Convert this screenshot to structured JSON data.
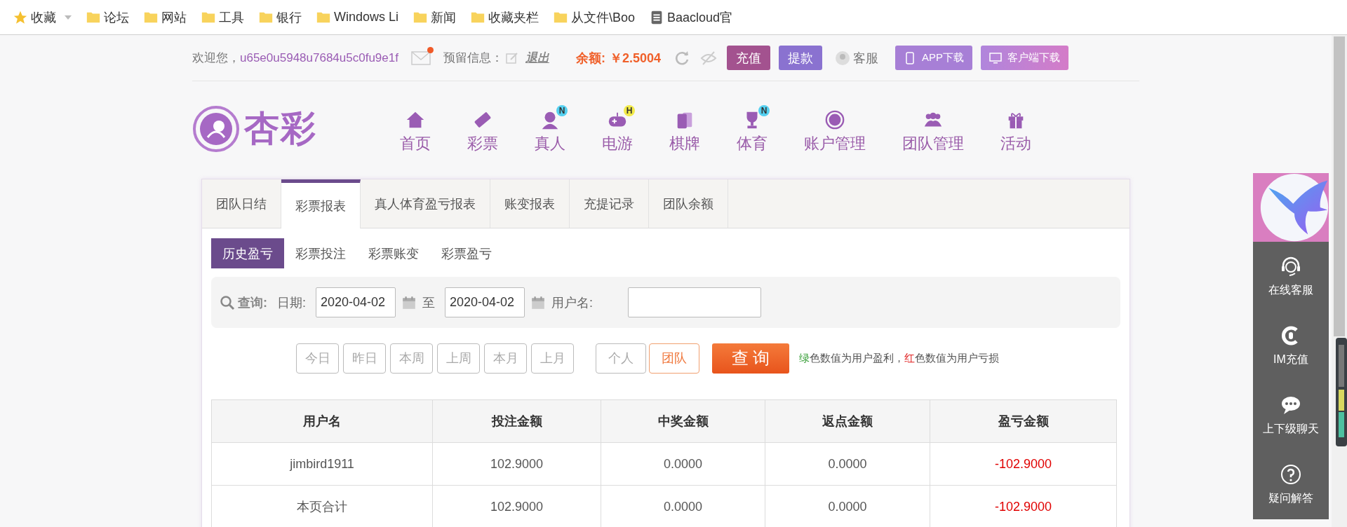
{
  "bookmarks": [
    {
      "label": "收藏",
      "kind": "star"
    },
    {
      "label": "论坛",
      "kind": "folder"
    },
    {
      "label": "网站",
      "kind": "folder"
    },
    {
      "label": "工具",
      "kind": "folder"
    },
    {
      "label": "银行",
      "kind": "folder"
    },
    {
      "label": "Windows Li",
      "kind": "folder"
    },
    {
      "label": "新闻",
      "kind": "folder"
    },
    {
      "label": "收藏夹栏",
      "kind": "folder"
    },
    {
      "label": "从文件\\Boo",
      "kind": "folder"
    },
    {
      "label": "Baacloud官",
      "kind": "page"
    }
  ],
  "account_bar": {
    "greeting": "欢迎您，",
    "username": "u65e0u5948u7684u5c0fu9e1f",
    "mail_unread": true,
    "reserve_label": "预留信息：",
    "logout": "退出",
    "balance_label": "余额:",
    "balance": "￥2.5004",
    "buttons": [
      {
        "label": "充值",
        "kind": "deposit"
      },
      {
        "label": "提款",
        "kind": "withdraw"
      }
    ],
    "service": "客服",
    "downloads": [
      {
        "label": "APP下载",
        "kind": "app"
      },
      {
        "label": "客户端下载",
        "kind": "client"
      }
    ]
  },
  "logo": {
    "text": "杏彩"
  },
  "nav": [
    {
      "label": "首页",
      "kind": "home"
    },
    {
      "label": "彩票",
      "kind": "ticket"
    },
    {
      "label": "真人",
      "kind": "live",
      "badge": {
        "text": "N",
        "color": "#55d0f0"
      }
    },
    {
      "label": "电游",
      "kind": "game",
      "badge": {
        "text": "H",
        "color": "#f2ea4a"
      }
    },
    {
      "label": "棋牌",
      "kind": "cards"
    },
    {
      "label": "体育",
      "kind": "sports",
      "badge": {
        "text": "N",
        "color": "#55d0f0"
      }
    },
    {
      "label": "账户管理",
      "kind": "account"
    },
    {
      "label": "团队管理",
      "kind": "team"
    },
    {
      "label": "活动",
      "kind": "gift"
    }
  ],
  "report_tabs": [
    {
      "label": "团队日结",
      "selected": false
    },
    {
      "label": "彩票报表",
      "selected": true
    },
    {
      "label": "真人体育盈亏报表",
      "selected": false
    },
    {
      "label": "账变报表",
      "selected": false
    },
    {
      "label": "充提记录",
      "selected": false
    },
    {
      "label": "团队余额",
      "selected": false
    }
  ],
  "sub_tabs": [
    {
      "label": "历史盈亏",
      "selected": true
    },
    {
      "label": "彩票投注",
      "selected": false
    },
    {
      "label": "彩票账变",
      "selected": false
    },
    {
      "label": "彩票盈亏",
      "selected": false
    }
  ],
  "query": {
    "label": "查询:",
    "date_label": "日期:",
    "start_date": "2020-04-02",
    "to": "至",
    "end_date": "2020-04-02",
    "username_label": "用户名:"
  },
  "quick_ranges": [
    "今日",
    "昨日",
    "本周",
    "上周",
    "本月",
    "上月"
  ],
  "scope": [
    {
      "label": "个人",
      "selected": false
    },
    {
      "label": "团队",
      "selected": true
    }
  ],
  "search_button": "查 询",
  "legend": {
    "green_word": "绿",
    "green_text": "色数值为用户盈利，",
    "red_word": "红",
    "red_text": "色数值为用户亏损"
  },
  "table": {
    "columns": [
      "用户名",
      "投注金额",
      "中奖金额",
      "返点金额",
      "盈亏金额"
    ],
    "rows": [
      {
        "cells": [
          "jimbird1911",
          "102.9000",
          "0.0000",
          "0.0000",
          "-102.9000"
        ],
        "loss": true
      },
      {
        "cells": [
          "本页合计",
          "102.9000",
          "0.0000",
          "0.0000",
          "-102.9000"
        ],
        "loss": true
      }
    ]
  },
  "side_menu": [
    {
      "label": "在线客服",
      "kind": "support"
    },
    {
      "label": "IM充值",
      "kind": "im"
    },
    {
      "label": "上下级聊天",
      "kind": "chat"
    },
    {
      "label": "疑问解答",
      "kind": "help"
    }
  ]
}
